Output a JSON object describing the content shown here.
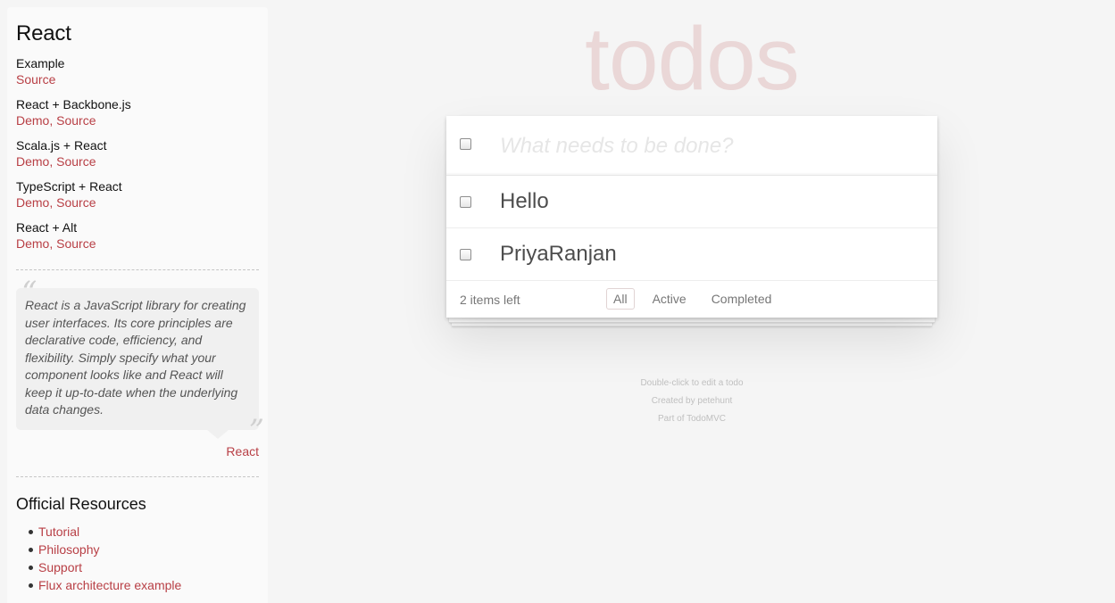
{
  "sidebar": {
    "title": "React",
    "examples": [
      {
        "name": "Example",
        "links": [
          "Source"
        ]
      },
      {
        "name": "React + Backbone.js",
        "links": [
          "Demo",
          "Source"
        ]
      },
      {
        "name": "Scala.js + React",
        "links": [
          "Demo",
          "Source"
        ]
      },
      {
        "name": "TypeScript + React",
        "links": [
          "Demo",
          "Source"
        ]
      },
      {
        "name": "React + Alt",
        "links": [
          "Demo",
          "Source"
        ]
      }
    ],
    "quote": {
      "text": "React is a JavaScript library for creating user interfaces. Its core principles are declarative code, efficiency, and flexibility. Simply specify what your component looks like and React will keep it up-to-date when the underlying data changes.",
      "source": "React"
    },
    "resources_title": "Official Resources",
    "resources": [
      "Tutorial",
      "Philosophy",
      "Support",
      "Flux architecture example"
    ]
  },
  "app": {
    "title": "todos",
    "new_todo_placeholder": "What needs to be done?",
    "todos": [
      {
        "label": "Hello",
        "completed": false
      },
      {
        "label": "PriyaRanjan",
        "completed": false
      }
    ],
    "footer": {
      "count": "2 items left",
      "filters": [
        "All",
        "Active",
        "Completed"
      ],
      "selected_filter": "All"
    }
  },
  "info": {
    "line1": "Double-click to edit a todo",
    "line2": "Created by petehunt",
    "line3": "Part of TodoMVC"
  },
  "colors": {
    "link": "#b83f45",
    "title": "#efd9da",
    "background": "#f5f5f5"
  }
}
